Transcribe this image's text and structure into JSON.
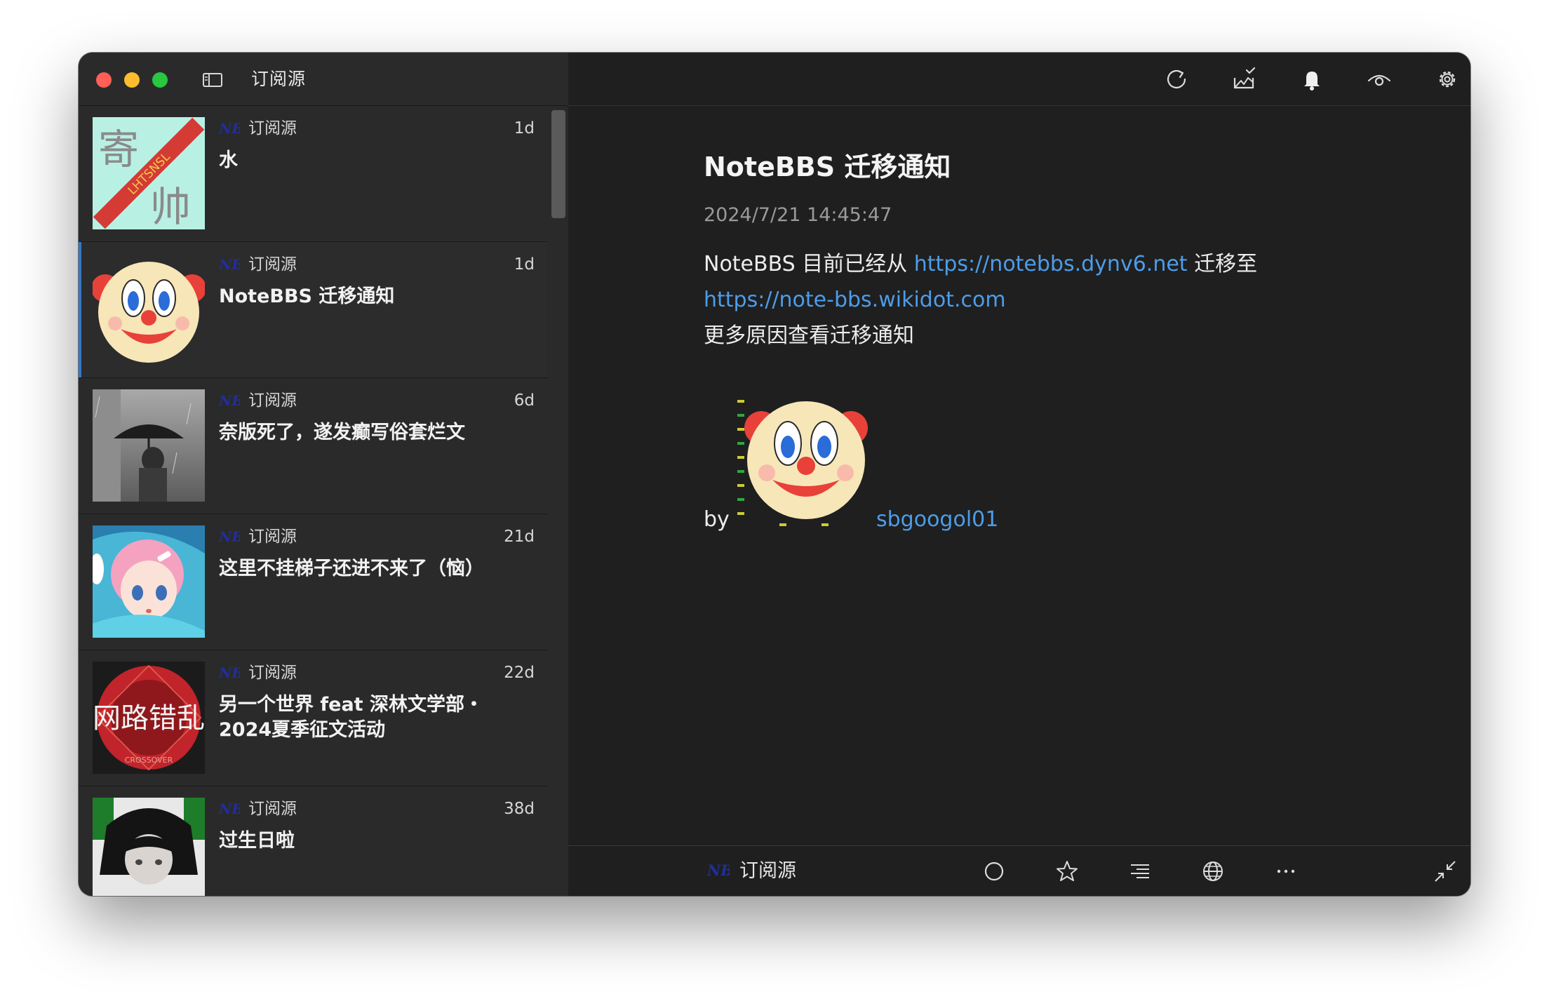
{
  "window": {
    "title": "订阅源"
  },
  "toolbar": {
    "icons": [
      "refresh-icon",
      "mark-all-read-icon",
      "notification-bell-icon",
      "view-mode-icon",
      "settings-gear-icon"
    ]
  },
  "feed_list": {
    "items": [
      {
        "source": "订阅源",
        "time": "1d",
        "title": "水",
        "thumbnail": "calligraphy-thumbnail",
        "selected": false
      },
      {
        "source": "订阅源",
        "time": "1d",
        "title": "NoteBBS 迁移通知",
        "thumbnail": "clown-face-thumbnail",
        "selected": true
      },
      {
        "source": "订阅源",
        "time": "6d",
        "title": "奈版死了，遂发癫写俗套烂文",
        "thumbnail": "umbrella-photo-thumbnail",
        "selected": false
      },
      {
        "source": "订阅源",
        "time": "21d",
        "title": "这里不挂梯子还进不来了（恼）",
        "thumbnail": "anime-girl-thumbnail",
        "selected": false
      },
      {
        "source": "订阅源",
        "time": "22d",
        "title": "另一个世界 feat 深林文学部・2024夏季征文活动",
        "thumbnail": "crossover-thumbnail",
        "selected": false
      },
      {
        "source": "订阅源",
        "time": "38d",
        "title": "过生日啦",
        "thumbnail": "dark-hair-avatar-thumbnail",
        "selected": false
      }
    ],
    "thumb_text": {
      "calligraphy_a": "寄",
      "calligraphy_b": "帅",
      "calligraphy_stamp": "LHTSNSL",
      "crossover_main": "网路错乱",
      "crossover_sub": "CROSSOVER"
    }
  },
  "article": {
    "title": "NoteBBS 迁移通知",
    "date": "2024/7/21 14:45:47",
    "body_prefix": "NoteBBS 目前已经从 ",
    "old_url": "https://notebbs.dynv6.net",
    "body_mid": " 迁移至",
    "new_url": "https://note-bbs.wikidot.com",
    "body_line3": "更多原因查看迁移通知",
    "by_label": "by",
    "author": "sbgoogol01"
  },
  "bottom_bar": {
    "source": "订阅源",
    "icons": [
      "mark-unread-circle-icon",
      "star-icon",
      "text-view-icon",
      "globe-icon",
      "more-icon",
      "exit-fullscreen-icon"
    ]
  },
  "colors": {
    "accent": "#3478c6",
    "link": "#4c9dea",
    "feed_logo": "#1f2f9a",
    "close": "#ff5f57",
    "minimize": "#febc2e",
    "maximize": "#28c840"
  }
}
